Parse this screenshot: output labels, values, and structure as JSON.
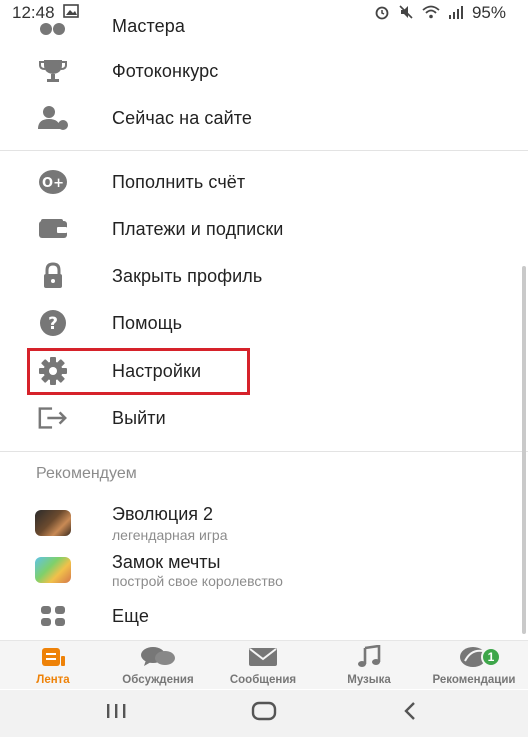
{
  "status_bar": {
    "time": "12:48",
    "battery": "95%"
  },
  "menu": {
    "items": [
      {
        "label": "Мастера",
        "icon": "masters-icon"
      },
      {
        "label": "Фотоконкурс",
        "icon": "trophy-icon"
      },
      {
        "label": "Сейчас на сайте",
        "icon": "online-users-icon"
      },
      {
        "label": "Пополнить счёт",
        "icon": "top-up-icon"
      },
      {
        "label": "Платежи и подписки",
        "icon": "wallet-icon"
      },
      {
        "label": "Закрыть профиль",
        "icon": "lock-icon"
      },
      {
        "label": "Помощь",
        "icon": "help-icon"
      },
      {
        "label": "Настройки",
        "icon": "gear-icon"
      },
      {
        "label": "Выйти",
        "icon": "logout-icon"
      }
    ]
  },
  "recommended": {
    "title": "Рекомендуем",
    "apps": [
      {
        "name": "Эволюция 2",
        "subtitle": "легендарная игра"
      },
      {
        "name": "Замок мечты",
        "subtitle": "построй свое королевство"
      }
    ],
    "more_label": "Еще"
  },
  "tabbar": {
    "tabs": [
      {
        "label": "Лента",
        "active": true
      },
      {
        "label": "Обсуждения",
        "active": false
      },
      {
        "label": "Сообщения",
        "active": false
      },
      {
        "label": "Музыка",
        "active": false
      },
      {
        "label": "Рекомендации",
        "active": false,
        "badge": "1"
      }
    ]
  },
  "colors": {
    "accent": "#ee8208",
    "icon_gray": "#777777",
    "highlight_red": "#d6222a",
    "badge_green": "#3ea64a"
  }
}
